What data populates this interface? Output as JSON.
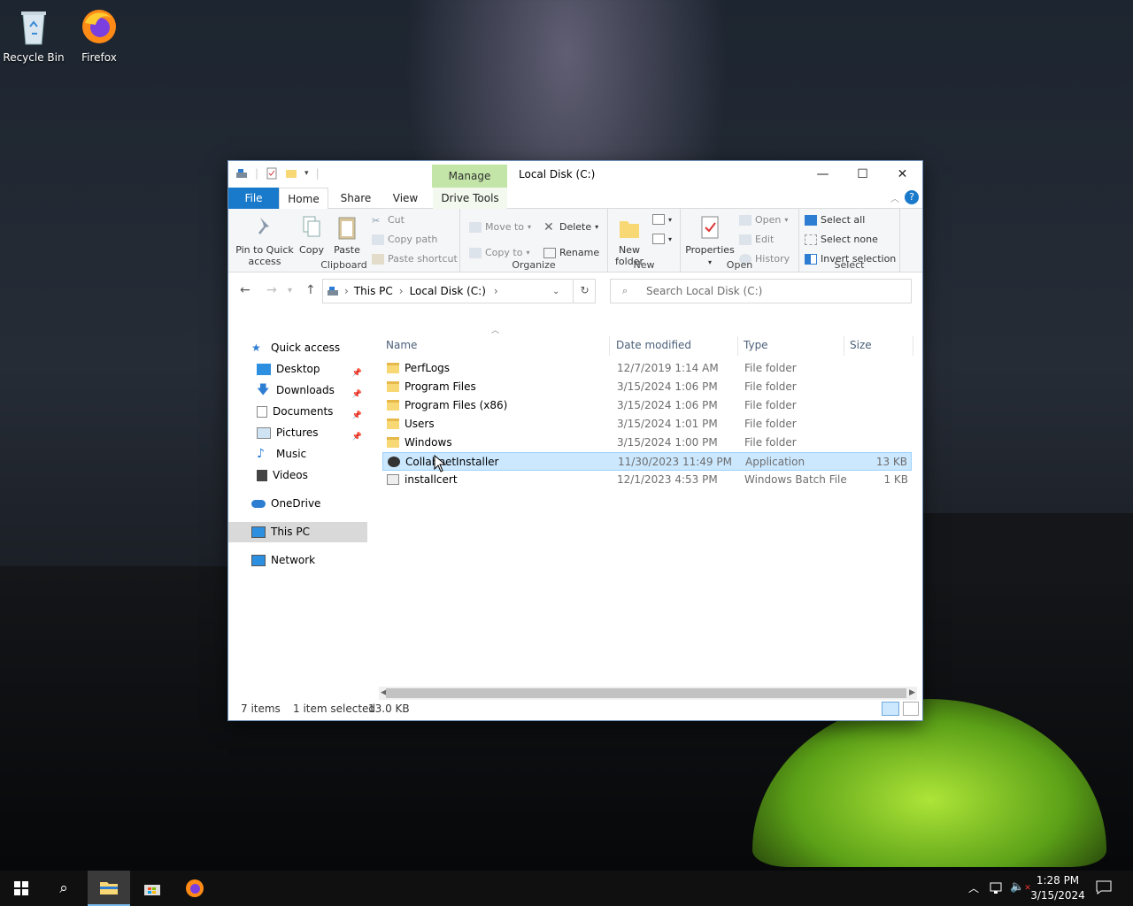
{
  "desktop": {
    "icons": [
      {
        "label": "Recycle Bin"
      },
      {
        "label": "Firefox"
      }
    ]
  },
  "window": {
    "title": "Local Disk (C:)",
    "manage_tab": "Manage",
    "tabs": {
      "file": "File",
      "home": "Home",
      "share": "Share",
      "view": "View",
      "drive_tools": "Drive Tools"
    },
    "ribbon": {
      "clipboard": {
        "label": "Clipboard",
        "pin": "Pin to Quick access",
        "copy": "Copy",
        "paste": "Paste",
        "cut": "Cut",
        "copy_path": "Copy path",
        "paste_shortcut": "Paste shortcut"
      },
      "organize": {
        "label": "Organize",
        "move_to": "Move to",
        "copy_to": "Copy to",
        "delete": "Delete",
        "rename": "Rename"
      },
      "new": {
        "label": "New",
        "new_folder": "New folder"
      },
      "open": {
        "label": "Open",
        "properties": "Properties",
        "open": "Open",
        "edit": "Edit",
        "history": "History"
      },
      "select": {
        "label": "Select",
        "select_all": "Select all",
        "select_none": "Select none",
        "invert": "Invert selection"
      }
    },
    "address": {
      "crumbs": [
        "This PC",
        "Local Disk (C:)"
      ],
      "search_placeholder": "Search Local Disk (C:)"
    },
    "nav": {
      "quick_access": "Quick access",
      "items": [
        "Desktop",
        "Downloads",
        "Documents",
        "Pictures",
        "Music",
        "Videos"
      ],
      "onedrive": "OneDrive",
      "this_pc": "This PC",
      "network": "Network"
    },
    "columns": {
      "name": "Name",
      "date": "Date modified",
      "type": "Type",
      "size": "Size"
    },
    "files": [
      {
        "name": "PerfLogs",
        "date": "12/7/2019 1:14 AM",
        "type": "File folder",
        "size": ""
      },
      {
        "name": "Program Files",
        "date": "3/15/2024 1:06 PM",
        "type": "File folder",
        "size": ""
      },
      {
        "name": "Program Files (x86)",
        "date": "3/15/2024 1:06 PM",
        "type": "File folder",
        "size": ""
      },
      {
        "name": "Users",
        "date": "3/15/2024 1:01 PM",
        "type": "File folder",
        "size": ""
      },
      {
        "name": "Windows",
        "date": "3/15/2024 1:00 PM",
        "type": "File folder",
        "size": ""
      },
      {
        "name": "CollabnetInstaller",
        "date": "11/30/2023 11:49 PM",
        "type": "Application",
        "size": "13 KB"
      },
      {
        "name": "installcert",
        "date": "12/1/2023 4:53 PM",
        "type": "Windows Batch File",
        "size": "1 KB"
      }
    ],
    "status": {
      "count": "7 items",
      "selected": "1 item selected",
      "size": "13.0 KB"
    }
  },
  "taskbar": {
    "time": "1:28 PM",
    "date": "3/15/2024"
  },
  "colors": {
    "accent": "#1979ca",
    "selection": "#cce8ff",
    "manage": "#c3e5a7"
  }
}
